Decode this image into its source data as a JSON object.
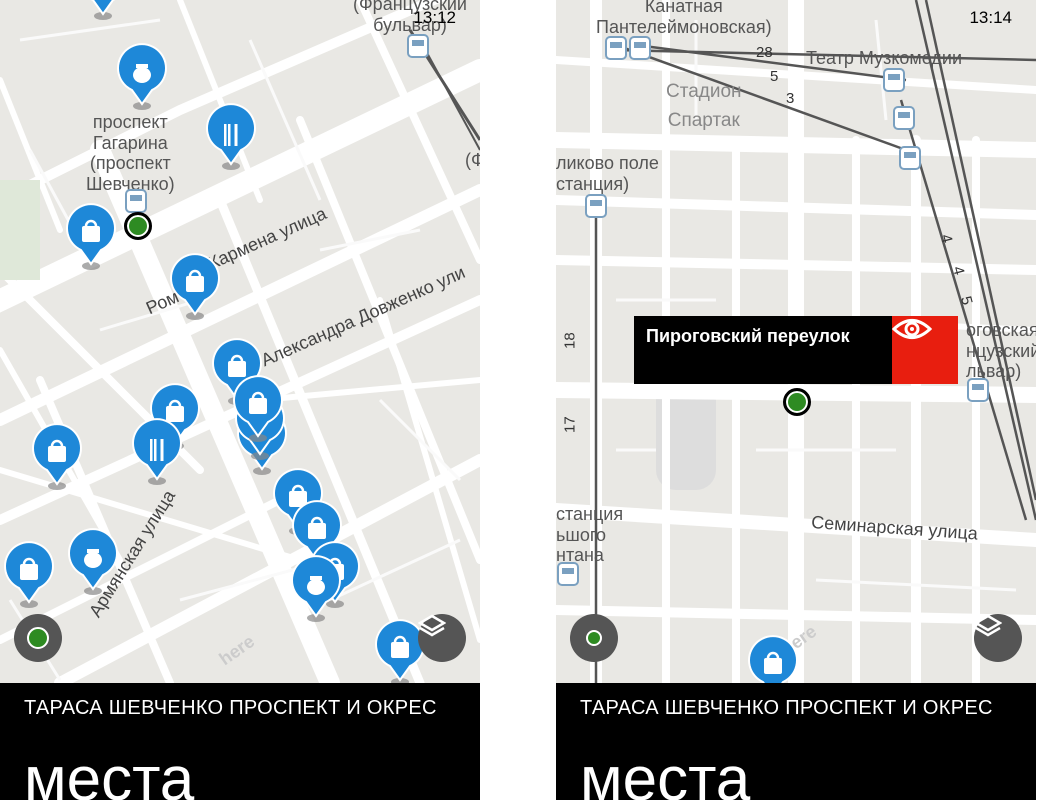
{
  "left": {
    "time": "13:12",
    "footer_subtitle": "ТАРАСА ШЕВЧЕНКО ПРОСПЕКТ И ОКРЕС",
    "footer_title": "места",
    "labels": {
      "l1": "(Французский\nбульвар)",
      "l2": "проспект\nГагарина\n(проспект\nШевченко)",
      "l3": "(Ф",
      "s1": "Кармена  улица",
      "s2": "Ром",
      "s3": "Александра  Довженко  ули",
      "s4": "Армянская  улица",
      "here": "here"
    }
  },
  "right": {
    "time": "13:14",
    "footer_subtitle": "ТАРАСА ШЕВЧЕНКО ПРОСПЕКТ И ОКРЕС",
    "footer_title": "места",
    "popup_title": "Пироговский переулок",
    "labels": {
      "r1": "Канатная\nПантелеймоновская)",
      "r2": "Театр Музкомедии",
      "r3": "Стадион\nСпартак",
      "r4": "ликово поле\nстанция)",
      "r5": "оговская\nнцузский\nльвар)",
      "r6": "станция\nьшого\nнтана",
      "r7": "Семинарская  улица",
      "n28": "28",
      "n5": "5",
      "n3": "3",
      "n4a": "4",
      "n4b": "4",
      "n5b": "5",
      "n18": "18",
      "n17": "17",
      "here": "here"
    }
  },
  "icons": {
    "shop": "shopping-bag-icon",
    "food": "fork-knife-icon",
    "cafe": "coffee-pot-icon",
    "tram": "tram-icon",
    "layers": "layers-icon",
    "eye": "eye-icon"
  },
  "colors": {
    "pin_blue": "#1e88d8",
    "accent_red": "#e81e0f",
    "location_green": "#2e8b22"
  }
}
